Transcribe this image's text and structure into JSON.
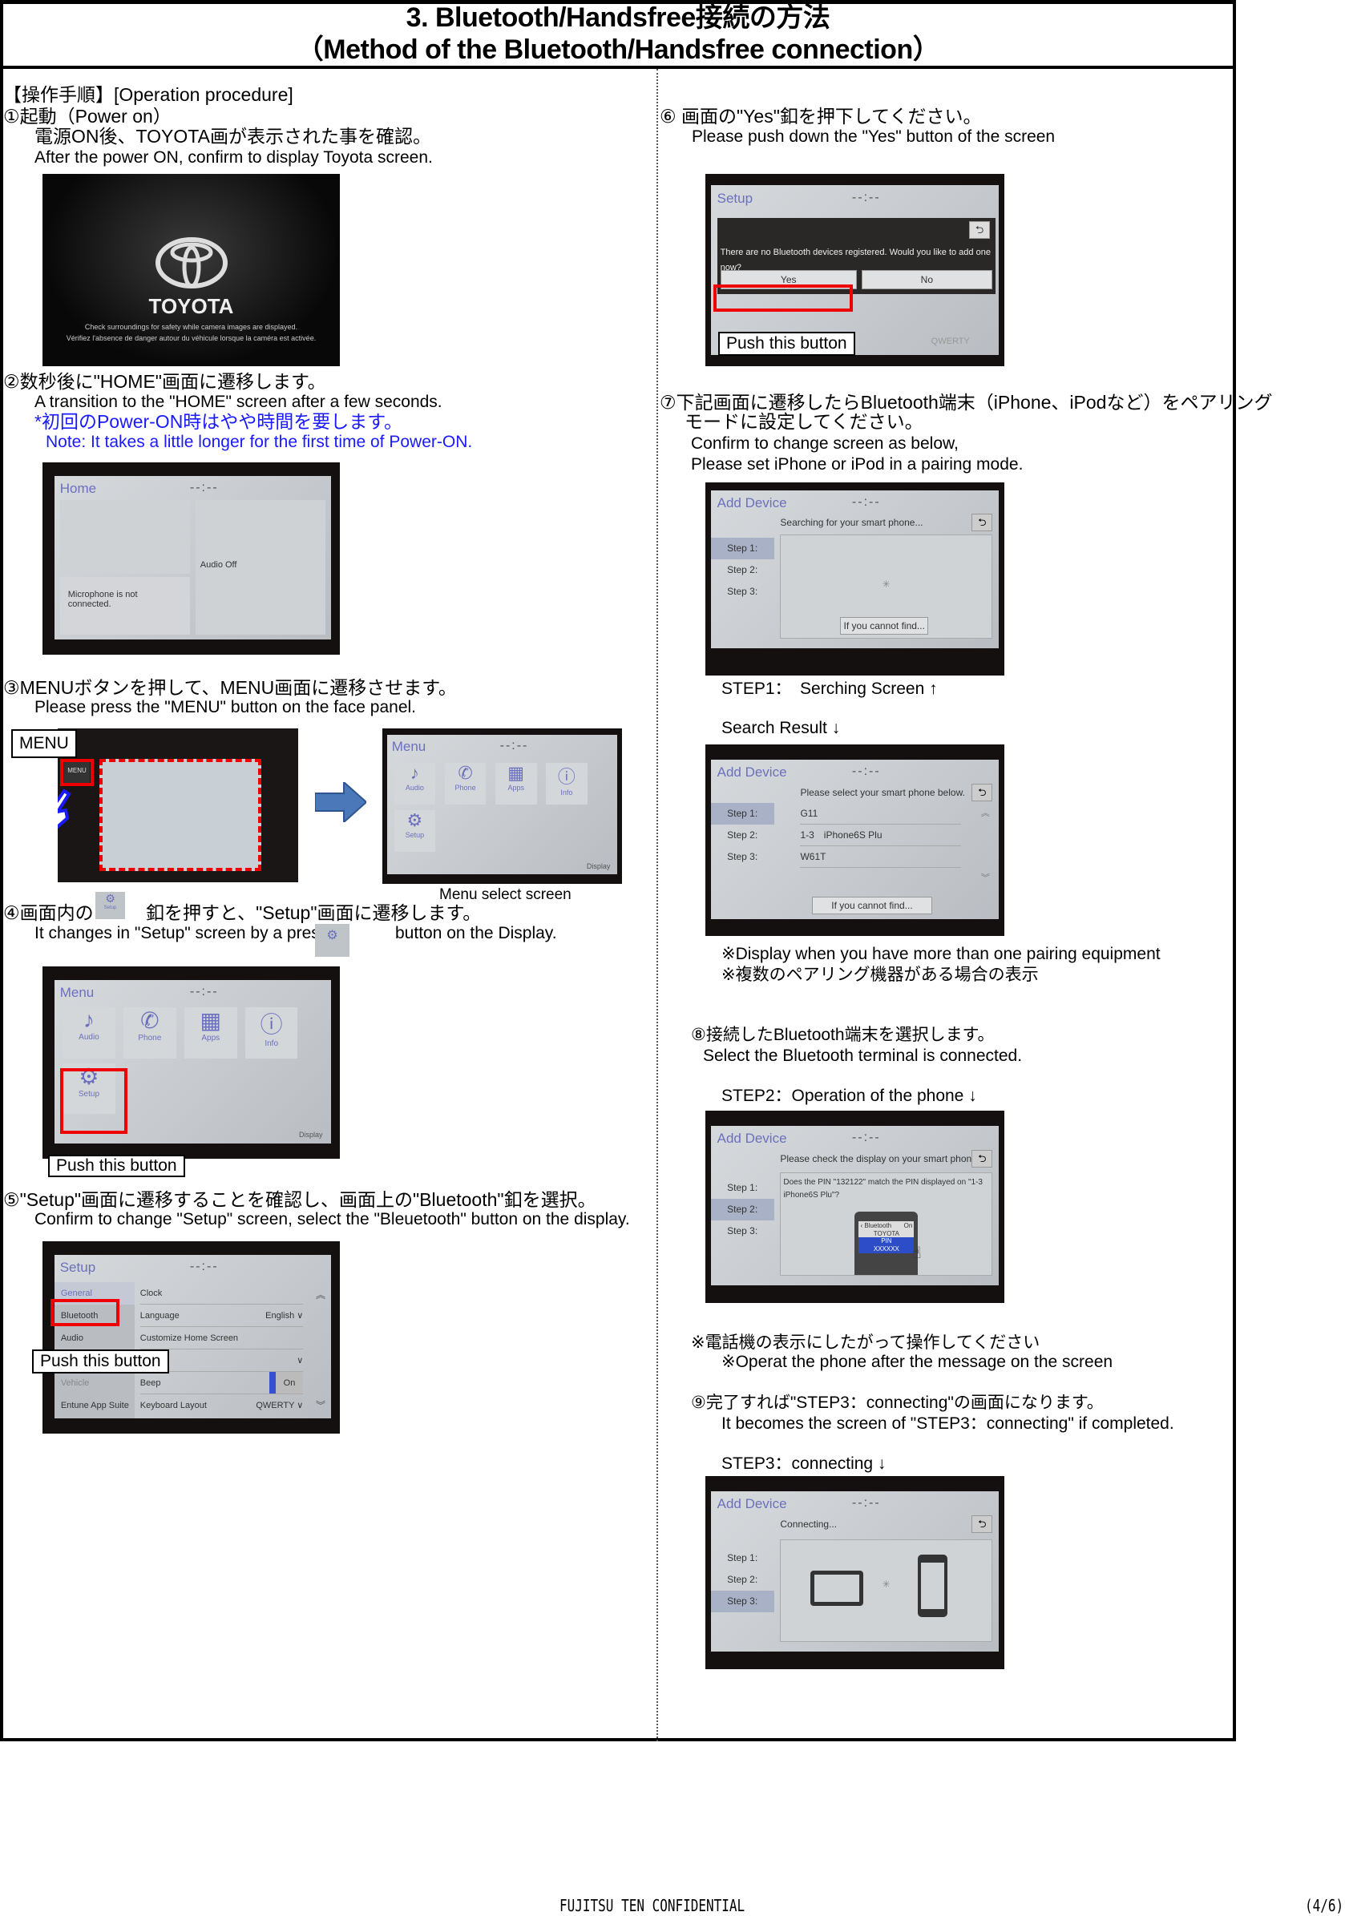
{
  "title": {
    "line1": "3. Bluetooth/Handsfree接続の方法",
    "line2": "（Method of the Bluetooth/Handsfree connection）"
  },
  "left": {
    "heading": "【操作手順】[Operation procedure]",
    "s1": {
      "ja_title": "①起動（Power on）",
      "ja": "電源ON後、TOYOTA画が表示された事を確認。",
      "en": "After the power ON, confirm to display Toyota screen.",
      "screen": {
        "brand": "TOYOTA",
        "line1": "Check surroundings for safety while camera images are displayed.",
        "line2": "Vérifiez l'absence de danger autour du véhicule lorsque la caméra est activée."
      }
    },
    "s2": {
      "ja_title": "②数秒後に\"HOME\"画面に遷移します。",
      "en": "A transition to the \"HOME\" screen after a few seconds.",
      "note_ja": "*初回のPower-ON時はやや時間を要します。",
      "note_en": "Note: It takes a little longer for the first time of Power-ON.",
      "screen": {
        "title": "Home",
        "clock": "--:--",
        "audio": "Audio Off",
        "mic": "Microphone is not connected."
      }
    },
    "s3": {
      "ja_title": "③MENUボタンを押して、MENU画面に遷移させます。",
      "en": "Please press the \"MENU\" button on the face panel.",
      "menu_callout": "MENU",
      "menu_key": "MENU",
      "caption": "Menu select screen",
      "menu_screen": {
        "title": "Menu",
        "clock": "--:--",
        "items": [
          "Audio",
          "Phone",
          "Apps",
          "Info",
          "Setup"
        ],
        "display": "Display"
      }
    },
    "s4": {
      "ja_a": "④画面内の",
      "ja_b": "釦を押すと、\"Setup\"画面に遷移します。",
      "en_a": "It changes in \"Setup\" screen by a pres",
      "en_b": "button on the Display.",
      "icon_label": "Setup",
      "callout": "Push this button"
    },
    "s5": {
      "ja_title": "⑤\"Setup\"画面に遷移することを確認し、画面上の\"Bluetooth\"釦を選択。",
      "en": "Confirm to change \"Setup\" screen, select the \"Bleuetooth\" button on the display.",
      "callout": "Push this button",
      "screen": {
        "title": "Setup",
        "clock": "--:--",
        "side": [
          "General",
          "Bluetooth",
          "Audio",
          "Vehicle",
          "Entune App Suite"
        ],
        "rows": [
          {
            "label": "Clock",
            "value": ""
          },
          {
            "label": "Language",
            "value": "English ∨"
          },
          {
            "label": "Customize Home Screen",
            "value": ""
          },
          {
            "label": "etting",
            "value": "∨"
          },
          {
            "label": "Beep",
            "value": "On"
          },
          {
            "label": "Keyboard Layout",
            "value": "QWERTY ∨"
          }
        ]
      }
    }
  },
  "right": {
    "s6": {
      "ja_title": "⑥ 画面の\"Yes\"釦を押下してください。",
      "en": "Please push down the \"Yes\" button of the screen",
      "callout": "Push this button",
      "screen": {
        "title": "Setup",
        "clock": "--:--",
        "message": "There are no Bluetooth devices registered. Would you like to add one now?",
        "yes": "Yes",
        "no": "No",
        "bg_value": "QWERTY"
      }
    },
    "s7": {
      "ja_line1": "⑦下記画面に遷移したらBluetooth端末（iPhone、iPodなど）をペアリング",
      "ja_line2": "モードに設定してください。",
      "en1": "Confirm to change screen as below,",
      "en2": "Please set iPhone or iPod in a pairing mode.",
      "screen": {
        "title": "Add Device",
        "clock": "--:--",
        "header": "Searching for your smart phone...",
        "steps": [
          "Step 1:",
          "Step 2:",
          "Step 3:"
        ],
        "button": "If you cannot find..."
      },
      "step1_caption": "STEP1：　Serching Screen ↑",
      "result_caption": "Search Result ↓",
      "result_screen": {
        "title": "Add Device",
        "clock": "--:--",
        "header": "Please select your smart phone below.",
        "steps": [
          "Step 1:",
          "Step 2:",
          "Step 3:"
        ],
        "devices": [
          "G11",
          "1-3　iPhone6S Plu",
          "W61T"
        ],
        "button": "If you cannot find..."
      },
      "note_en": "※Display when you have more than one pairing equipment",
      "note_ja": "※複数のペアリング機器がある場合の表示"
    },
    "s8": {
      "ja_title": "⑧接続したBluetooth端末を選択します。",
      "en": "Select the Bluetooth terminal is connected.",
      "caption": "STEP2：Operation of the phone ↓",
      "screen": {
        "title": "Add Device",
        "clock": "--:--",
        "header": "Please check the display on your smart phone.",
        "steps": [
          "Step 1:",
          "Step 2:",
          "Step 3:"
        ],
        "message": "Does the PIN \"132122\" match the PIN displayed on \"1-3　iPhone6S Plu\"?",
        "phone_bt": "‹ Bluetooth",
        "phone_on": "On",
        "phone_name": "TOYOTA",
        "pin": "PIN",
        "pin_value": "XXXXXX"
      },
      "note_ja": "※電話機の表示にしたがって操作してください",
      "note_en": "※Operat the phone after the message on the screen"
    },
    "s9": {
      "ja_title": "⑨完了すれば\"STEP3：connecting\"の画面になります。",
      "en": "It becomes the screen of \"STEP3：connecting\" if completed.",
      "caption": "STEP3：connecting ↓",
      "screen": {
        "title": "Add Device",
        "clock": "--:--",
        "header": "Connecting...",
        "steps": [
          "Step 1:",
          "Step 2:",
          "Step 3:"
        ]
      }
    }
  },
  "footer": {
    "confidential": "FUJITSU TEN CONFIDENTIAL",
    "page": "(4/6)"
  },
  "colors": {
    "highlight_red": "#e00000",
    "note_blue": "#1a1aff",
    "screen_title": "#6b70bd",
    "arrow": "#4a78b8"
  }
}
